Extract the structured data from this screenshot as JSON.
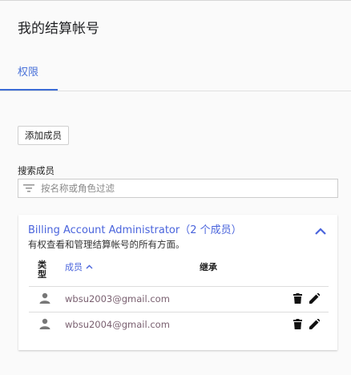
{
  "header": {
    "title": "我的结算帐号"
  },
  "tabs": [
    {
      "label": "权限",
      "active": true
    }
  ],
  "toolbar": {
    "add_member_label": "添加成员"
  },
  "search": {
    "label": "搜索成员",
    "placeholder": "按名称或角色过滤",
    "value": ""
  },
  "role_card": {
    "title": "Billing Account Administrator（2 个成员）",
    "description": "有权查看和管理结算帐号的所有方面。",
    "columns": {
      "type": "类型",
      "member": "成员",
      "inherit": "继承"
    },
    "members": [
      {
        "email": "wbsu2003@gmail.com",
        "type_icon": "person-icon"
      },
      {
        "email": "wbsu2004@gmail.com",
        "type_icon": "person-icon"
      }
    ]
  },
  "colors": {
    "accent": "#4a64dc",
    "tab_indicator": "#3b6bd6"
  }
}
